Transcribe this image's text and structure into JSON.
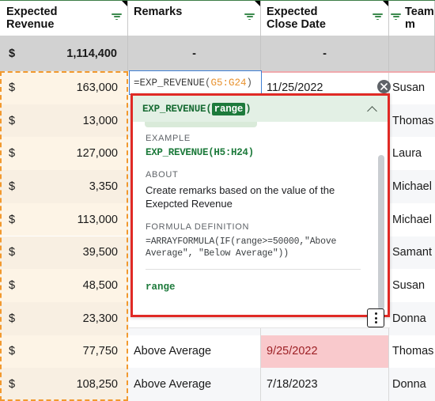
{
  "spreadsheet": {
    "columns": [
      {
        "id": "expected_revenue",
        "label": "Expected\nRevenue",
        "filter_icon": "filter-icon"
      },
      {
        "id": "remarks",
        "label": "Remarks",
        "filter_icon": "filter-icon"
      },
      {
        "id": "expected_close_date",
        "label": "Expected\nClose Date",
        "filter_icon": "filter-icon"
      },
      {
        "id": "team_member",
        "label": "Team m",
        "filter_icon": "filter-icon"
      }
    ],
    "header": {
      "col1_line1": "Expected",
      "col1_line2": "Revenue",
      "col2": "Remarks",
      "col3_line1": "Expected",
      "col3_line2": "Close Date",
      "col4": "Team m"
    },
    "total_row": {
      "currency": "$",
      "amount": "1,114,400",
      "remarks": "-",
      "close_date": "-",
      "team_member": ""
    },
    "rows": [
      {
        "currency": "$",
        "amount": "163,000",
        "remarks": "",
        "close_date": "11/25/2022",
        "date_alert": false,
        "team_member": "Susan"
      },
      {
        "currency": "$",
        "amount": "13,000",
        "remarks": "",
        "close_date": "",
        "date_alert": false,
        "team_member": "Thomas"
      },
      {
        "currency": "$",
        "amount": "127,000",
        "remarks": "",
        "close_date": "",
        "date_alert": false,
        "team_member": "Laura"
      },
      {
        "currency": "$",
        "amount": "3,350",
        "remarks": "",
        "close_date": "",
        "date_alert": false,
        "team_member": "Michael"
      },
      {
        "currency": "$",
        "amount": "113,000",
        "remarks": "",
        "close_date": "",
        "date_alert": false,
        "team_member": "Michael"
      },
      {
        "currency": "$",
        "amount": "39,500",
        "remarks": "",
        "close_date": "",
        "date_alert": false,
        "team_member": "Samant"
      },
      {
        "currency": "$",
        "amount": "48,500",
        "remarks": "",
        "close_date": "",
        "date_alert": false,
        "team_member": "Susan"
      },
      {
        "currency": "$",
        "amount": "23,300",
        "remarks": "",
        "close_date": "",
        "date_alert": false,
        "team_member": "Donna"
      },
      {
        "currency": "$",
        "amount": "77,750",
        "remarks": "Above Average",
        "close_date": "9/25/2022",
        "date_alert": true,
        "team_member": "Thomas"
      },
      {
        "currency": "$",
        "amount": "108,250",
        "remarks": "Above Average",
        "close_date": "7/18/2023",
        "date_alert": false,
        "team_member": "Donna"
      }
    ]
  },
  "formula_bar": {
    "prefix": "=EXP_REVENUE",
    "open_paren": "(",
    "range": "G5:G24",
    "close_paren": ")"
  },
  "help_tooltip": {
    "signature_name": "EXP_REVENUE",
    "signature_open": "(",
    "signature_param": "range",
    "signature_close": ")",
    "collapse_icon": "chevron-up-icon",
    "example_label": "EXAMPLE",
    "example_code": "EXP_REVENUE(H5:H24)",
    "about_label": "ABOUT",
    "about_text": "Create remarks based on the value of the Exepcted Revenue",
    "definition_label": "FORMULA DEFINITION",
    "definition_code": "=ARRAYFORMULA(IF(range>=50000,\"Above\nAverage\", \"Below Average\"))",
    "param_name": "range"
  },
  "controls": {
    "close_badge": "close-icon",
    "overflow_menu": "more-options-icon"
  },
  "colors": {
    "accent_green": "#1d7a3b",
    "tooltip_border_red": "#e02a25",
    "selection_orange": "#f2992e",
    "formula_border_blue": "#3f7fd4",
    "alert_pink": "#f9c9cc",
    "alert_text": "#9c1f24",
    "range_text_orange": "#e8912d"
  }
}
